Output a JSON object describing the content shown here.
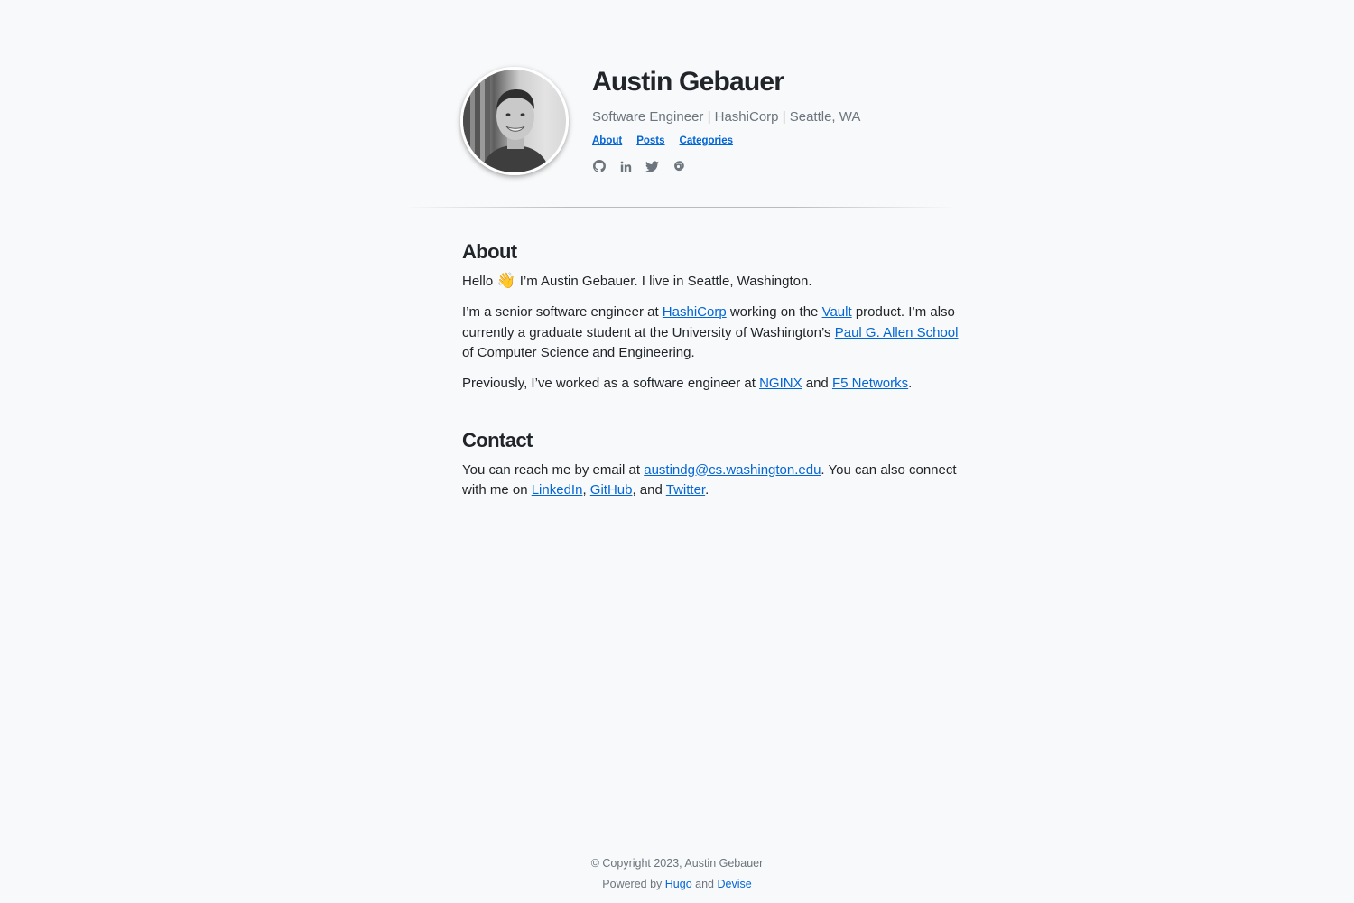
{
  "header": {
    "name": "Austin Gebauer",
    "tagline": "Software Engineer | HashiCorp | Seattle, WA",
    "nav": [
      {
        "label": "About"
      },
      {
        "label": "Posts"
      },
      {
        "label": "Categories"
      }
    ],
    "social": [
      "github-icon",
      "linkedin-icon",
      "twitter-icon",
      "email-icon"
    ]
  },
  "about": {
    "heading": "About",
    "p1_pre": "Hello",
    "p1_emoji": "👋",
    "p1_post": "I’m Austin Gebauer. I live in Seattle, Washington.",
    "p2_a": "I’m a senior software engineer at",
    "p2_link_hashicorp": "HashiCorp",
    "p2_b": "working on the",
    "p2_link_vault": "Vault",
    "p2_c": "product. I’m also currently a graduate student at the University of Washington’s",
    "p2_link_allen": "Paul G. Allen School",
    "p2_d": "of Computer Science and Engineering.",
    "p3_a": "Previously, I’ve worked as a software engineer at",
    "p3_link_nginx": "NGINX",
    "p3_b": "and",
    "p3_link_f5": "F5 Networks",
    "p3_c": "."
  },
  "contact": {
    "heading": "Contact",
    "a": "You can reach me by email at",
    "email": "austindg@cs.washington.edu",
    "b": ". You can also connect with me on",
    "link_linkedin": "LinkedIn",
    "c": ",",
    "link_github": "GitHub",
    "d": ", and",
    "link_twitter": "Twitter",
    "e": "."
  },
  "footer": {
    "copyright": "© Copyright 2023, Austin Gebauer",
    "powered_pre": "Powered by",
    "link_hugo": "Hugo",
    "and": "and",
    "link_devise": "Devise"
  },
  "colors": {
    "background": "#f8f9fa",
    "text": "#212529",
    "muted": "#6c757d",
    "link": "#0366d6"
  }
}
